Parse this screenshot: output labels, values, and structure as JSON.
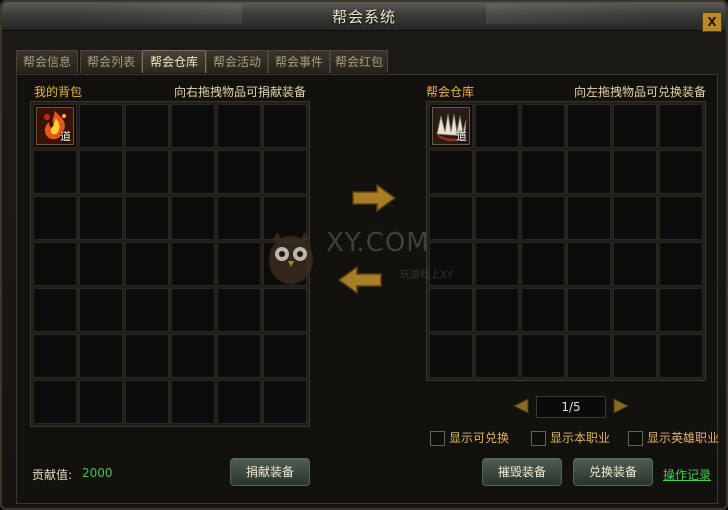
{
  "window": {
    "title": "帮会系统",
    "close_label": "X"
  },
  "tabs": [
    "帮会信息",
    "帮会列表",
    "帮会仓库",
    "帮会活动",
    "帮会事件",
    "帮会红包"
  ],
  "active_tab": "帮会仓库",
  "left_panel": {
    "title": "我的背包",
    "hint": "向右拖拽物品可捐献装备",
    "items": [
      {
        "icon": "flame-dragon-equipment-icon",
        "tag": "道"
      }
    ]
  },
  "right_panel": {
    "title": "帮会仓库",
    "hint": "向左拖拽物品可兑换装备",
    "items": [
      {
        "icon": "fan-wing-equipment-icon",
        "tag": "道"
      }
    ]
  },
  "pager": {
    "value": "1/5"
  },
  "filters": [
    "显示可兑换",
    "显示本职业",
    "显示英雄职业"
  ],
  "footer": {
    "contribution_label": "贡献值:",
    "contribution_value": "2000",
    "donate_button": "捐献装备",
    "destroy_button": "摧毁装备",
    "exchange_button": "兑换装备",
    "log_link": "操作记录"
  },
  "watermark": {
    "text": "XY.COM",
    "subtext": "玩游戏上XY"
  },
  "colors": {
    "gold": "#e7b544",
    "green": "#3fc64a",
    "cell_bg": "#0c0c0c"
  }
}
